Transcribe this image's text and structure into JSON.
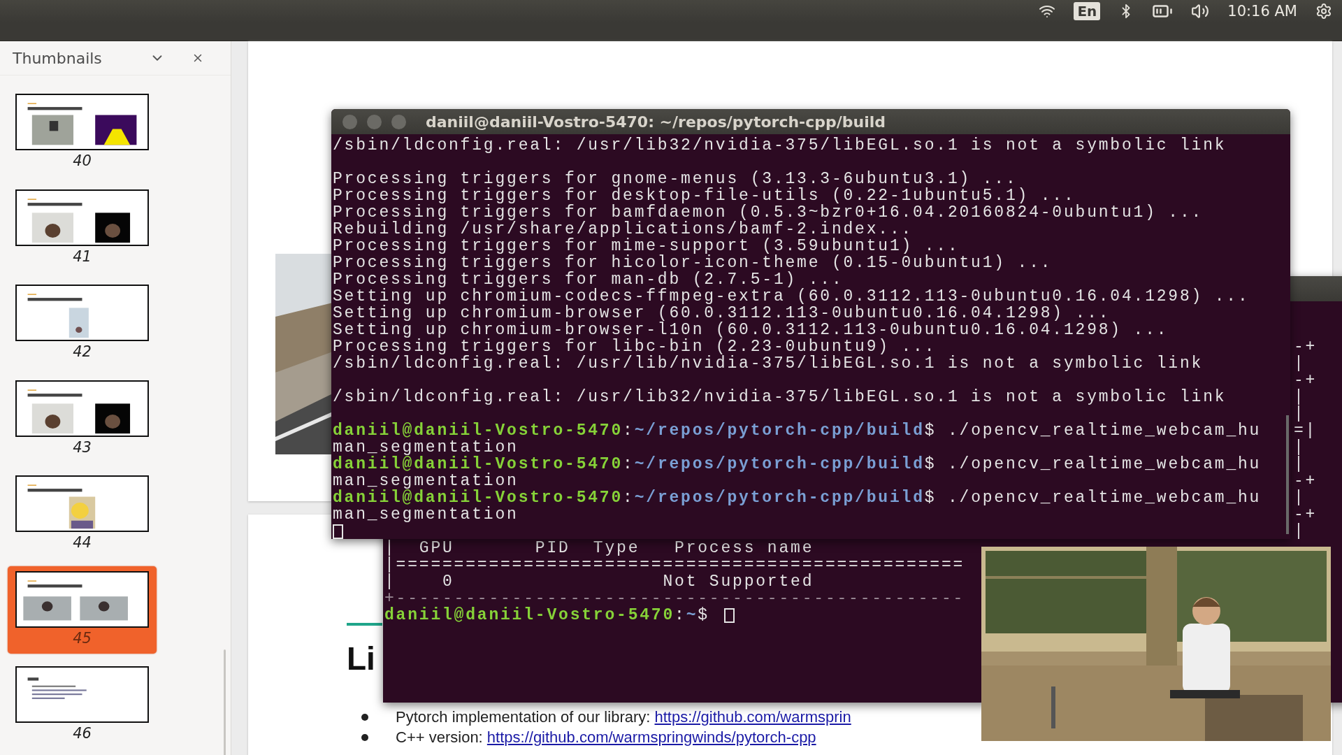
{
  "top_bar": {
    "keyboard_layout": "En",
    "clock": "10:16 AM"
  },
  "sidebar": {
    "title": "Thumbnails",
    "thumbnails": [
      {
        "number": "40",
        "kind": "mask",
        "selected": false
      },
      {
        "number": "41",
        "kind": "dark",
        "selected": false
      },
      {
        "number": "42",
        "kind": "single",
        "selected": false
      },
      {
        "number": "43",
        "kind": "dark",
        "selected": false
      },
      {
        "number": "44",
        "kind": "glow",
        "selected": false
      },
      {
        "number": "45",
        "kind": "pair",
        "selected": true
      },
      {
        "number": "46",
        "kind": "text",
        "selected": false
      }
    ]
  },
  "slide": {
    "heading": "Li",
    "bullets": [
      {
        "text": "Pytorch implementation of our library: ",
        "link": "https://github.com/warmsprin"
      },
      {
        "text": "C++ version: ",
        "link": "https://github.com/warmspringwinds/pytorch-cpp"
      }
    ]
  },
  "terminal_front": {
    "title": "daniil@daniil-Vostro-5470: ~/repos/pytorch-cpp/build",
    "lines": [
      {
        "kind": "output",
        "text": "/sbin/ldconfig.real: /usr/lib32/nvidia-375/libEGL.so.1 is not a symbolic link"
      },
      {
        "kind": "blank"
      },
      {
        "kind": "output",
        "text": "Processing triggers for gnome-menus (3.13.3-6ubuntu3.1) ..."
      },
      {
        "kind": "output",
        "text": "Processing triggers for desktop-file-utils (0.22-1ubuntu5.1) ..."
      },
      {
        "kind": "output",
        "text": "Processing triggers for bamfdaemon (0.5.3~bzr0+16.04.20160824-0ubuntu1) ..."
      },
      {
        "kind": "output",
        "text": "Rebuilding /usr/share/applications/bamf-2.index..."
      },
      {
        "kind": "output",
        "text": "Processing triggers for mime-support (3.59ubuntu1) ..."
      },
      {
        "kind": "output",
        "text": "Processing triggers for hicolor-icon-theme (0.15-0ubuntu1) ..."
      },
      {
        "kind": "output",
        "text": "Processing triggers for man-db (2.7.5-1) ..."
      },
      {
        "kind": "output",
        "text": "Setting up chromium-codecs-ffmpeg-extra (60.0.3112.113-0ubuntu0.16.04.1298) ..."
      },
      {
        "kind": "output",
        "text": "Setting up chromium-browser (60.0.3112.113-0ubuntu0.16.04.1298) ..."
      },
      {
        "kind": "output",
        "text": "Setting up chromium-browser-l10n (60.0.3112.113-0ubuntu0.16.04.1298) ..."
      },
      {
        "kind": "output",
        "text": "Processing triggers for libc-bin (2.23-0ubuntu9) ..."
      },
      {
        "kind": "output",
        "text": "/sbin/ldconfig.real: /usr/lib/nvidia-375/libEGL.so.1 is not a symbolic link"
      },
      {
        "kind": "blank"
      },
      {
        "kind": "output",
        "text": "/sbin/ldconfig.real: /usr/lib32/nvidia-375/libEGL.so.1 is not a symbolic link"
      },
      {
        "kind": "blank"
      },
      {
        "kind": "prompt",
        "user": "daniil@daniil-Vostro-5470",
        "sep": ":",
        "path": "~/repos/pytorch-cpp/build",
        "symbol": "$",
        "command": "./opencv_realtime_webcam_hu"
      },
      {
        "kind": "output",
        "text": "man_segmentation"
      },
      {
        "kind": "prompt",
        "user": "daniil@daniil-Vostro-5470",
        "sep": ":",
        "path": "~/repos/pytorch-cpp/build",
        "symbol": "$",
        "command": "./opencv_realtime_webcam_hu"
      },
      {
        "kind": "output",
        "text": "man_segmentation"
      },
      {
        "kind": "prompt",
        "user": "daniil@daniil-Vostro-5470",
        "sep": ":",
        "path": "~/repos/pytorch-cpp/build",
        "symbol": "$",
        "command": "./opencv_realtime_webcam_hu"
      },
      {
        "kind": "output",
        "text": "man_segmentation"
      },
      {
        "kind": "cursor"
      }
    ]
  },
  "terminal_back": {
    "rows": [
      {
        "kind": "edge",
        "text": "-+"
      },
      {
        "kind": "edge",
        "text": "|"
      },
      {
        "kind": "edge",
        "text": "-+"
      },
      {
        "kind": "edge",
        "text": "|"
      },
      {
        "kind": "edge",
        "text": "|"
      },
      {
        "kind": "edge",
        "text": "=|"
      },
      {
        "kind": "edge",
        "text": "|"
      },
      {
        "kind": "edge",
        "text": "|"
      },
      {
        "kind": "edge",
        "text": "-+"
      },
      {
        "kind": "edge",
        "text": "|"
      },
      {
        "kind": "edge",
        "text": "-+"
      },
      {
        "kind": "edge",
        "text": "|"
      },
      {
        "kind": "table",
        "text": "|  GPU       PID  Type   Process name"
      },
      {
        "kind": "table",
        "text": "|================================================="
      },
      {
        "kind": "table",
        "text": "|    0                  Not Supported"
      },
      {
        "kind": "rule",
        "text": "+-------------------------------------------------"
      },
      {
        "kind": "prompt",
        "user": "daniil@daniil-Vostro-5470",
        "sep": ":",
        "path": "~",
        "symbol": "$"
      }
    ]
  }
}
